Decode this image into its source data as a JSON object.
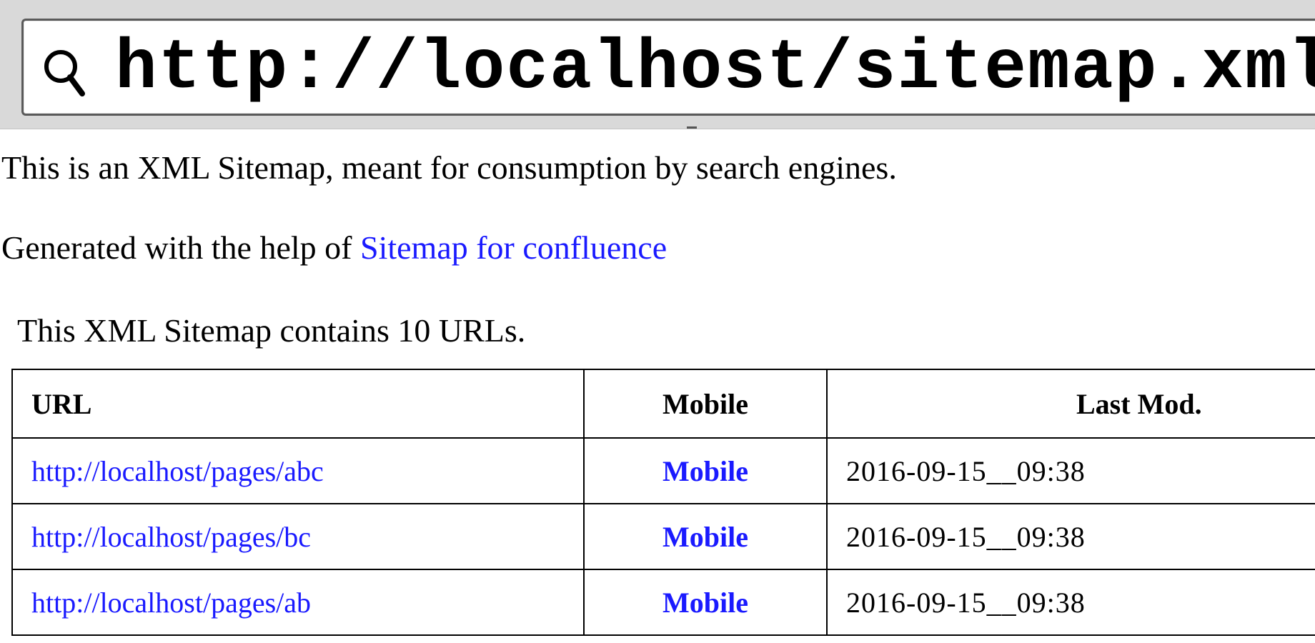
{
  "browser": {
    "address": "http://localhost/sitemap.xml",
    "search_icon": "search-icon"
  },
  "page": {
    "intro": "This is an XML Sitemap, meant for consumption by search engines.",
    "generated_prefix": "Generated with the help of ",
    "generated_link": "Sitemap for confluence",
    "count_text": "This XML Sitemap contains 10 URLs."
  },
  "table": {
    "headers": {
      "url": "URL",
      "mobile": "Mobile",
      "last_mod": "Last Mod."
    },
    "rows": [
      {
        "url": "http://localhost/pages/abc",
        "mobile": "Mobile",
        "last_mod": "2016-09-15__09:38"
      },
      {
        "url": "http://localhost/pages/bc",
        "mobile": "Mobile",
        "last_mod": "2016-09-15__09:38"
      },
      {
        "url": "http://localhost/pages/ab",
        "mobile": "Mobile",
        "last_mod": "2016-09-15__09:38"
      }
    ]
  },
  "colors": {
    "link": "#1a1aff",
    "chrome": "#d9d9d9"
  }
}
